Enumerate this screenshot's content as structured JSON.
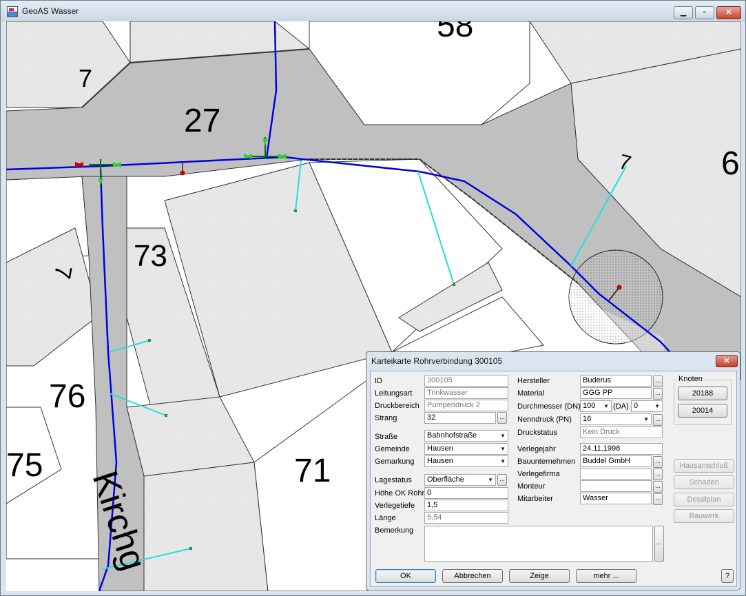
{
  "window": {
    "title": "GeoAS Wasser",
    "minimize": "▁",
    "maximize": "▫",
    "close": "✕"
  },
  "map": {
    "parcels": [
      "7",
      "27",
      "73",
      "7",
      "76",
      "75",
      "71",
      "58",
      "6",
      "7"
    ],
    "street": "Kirchg",
    "colors": {
      "road": "#c0c0c0",
      "parcel": "#e6e6e6",
      "pipe": "#0000e0",
      "house_connection": "#20e0e0",
      "fitting": "#00a000",
      "valve": "#d00000"
    }
  },
  "dialog": {
    "title": "Karteikarte Rohrverbindung 300105",
    "close": "✕",
    "left": [
      {
        "label": "ID",
        "value": "300105",
        "type": "readonly"
      },
      {
        "label": "Leitungsart",
        "value": "Trinkwasser",
        "type": "readonly"
      },
      {
        "label": "Druckbereich",
        "value": "Pumpendruck 2",
        "type": "readonly"
      },
      {
        "label": "Strang",
        "value": "32",
        "type": "text"
      },
      {
        "label": "Straße",
        "value": "Bahnhofstraße",
        "type": "select"
      },
      {
        "label": "Gemeinde",
        "value": "Hausen",
        "type": "select"
      },
      {
        "label": "Gemarkung",
        "value": "Hausen",
        "type": "select"
      },
      {
        "label": "Lagestatus",
        "value": "Oberfläche",
        "type": "select"
      },
      {
        "label": "Höhe OK Rohr",
        "value": "0",
        "type": "text"
      },
      {
        "label": "Verlegetiefe",
        "value": "1,5",
        "type": "text"
      },
      {
        "label": "Länge",
        "value": "5,54",
        "type": "readonly"
      },
      {
        "label": "Bemerkung",
        "value": "",
        "type": "textarea"
      }
    ],
    "right": [
      {
        "label": "Hersteller",
        "value": "Buderus"
      },
      {
        "label": "Material",
        "value": "GGG PP"
      },
      {
        "label": "Durchmesser (DN)",
        "value": "100",
        "da_label": "(DA)",
        "da_value": "0"
      },
      {
        "label": "Nenndruck (PN)",
        "value": "16"
      },
      {
        "label": "Druckstatus",
        "value": "Kein Druck"
      },
      {
        "label": "Verlegejahr",
        "value": "24.11.1998"
      },
      {
        "label": "Bauunternehmen",
        "value": "Buddel GmbH"
      },
      {
        "label": "Verlegefirma",
        "value": ""
      },
      {
        "label": "Monteur",
        "value": ""
      },
      {
        "label": "Mitarbeiter",
        "value": "Wasser"
      }
    ],
    "knoten": {
      "label": "Knoten",
      "nodes": [
        "20188",
        "20014"
      ]
    },
    "side_buttons": [
      "Hausanschluß",
      "Schaden",
      "Detailplan",
      "Bauwerk"
    ],
    "bottom_buttons": [
      "OK",
      "Abbrechen",
      "Zeige",
      "mehr ..."
    ],
    "help": "?",
    "ellipsis": "..."
  }
}
